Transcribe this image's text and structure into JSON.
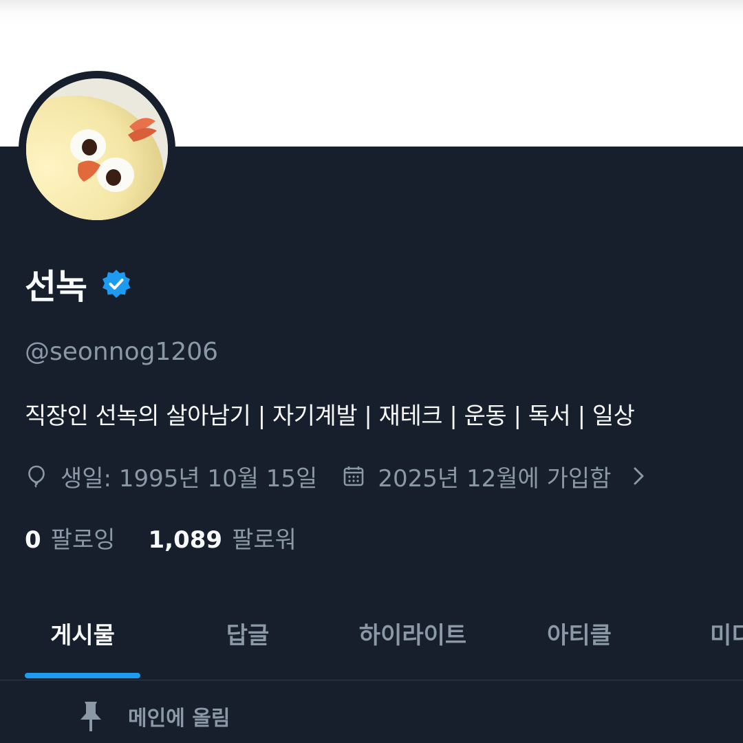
{
  "profile": {
    "display_name": "선녹",
    "handle": "@seonnog1206",
    "bio": "직장인 선녹의 살아남기 | 자기계발 | 재테크 | 운동 | 독서 | 일상",
    "birthday": "생일: 1995년 10월 15일",
    "joined": "2025년 12월에 가입함",
    "verified": true
  },
  "stats": {
    "following_count": "0",
    "following_label": "팔로잉",
    "followers_count": "1,089",
    "followers_label": "팔로워"
  },
  "tabs": [
    {
      "label": "게시물",
      "active": true
    },
    {
      "label": "답글",
      "active": false
    },
    {
      "label": "하이라이트",
      "active": false
    },
    {
      "label": "아티클",
      "active": false
    },
    {
      "label": "미디어",
      "active": false
    }
  ],
  "pinned": {
    "label": "메인에 올림"
  },
  "icons": {
    "verified": "verified-badge-icon",
    "birthday": "balloon-icon",
    "joined": "calendar-icon",
    "more": "chevron-right-icon",
    "pinned": "pin-icon"
  },
  "colors": {
    "background": "#15202b",
    "accent": "#1d9bf0",
    "verified": "#1d9bf0",
    "text_primary": "#f7f9f9",
    "text_secondary": "#8b98a5"
  }
}
